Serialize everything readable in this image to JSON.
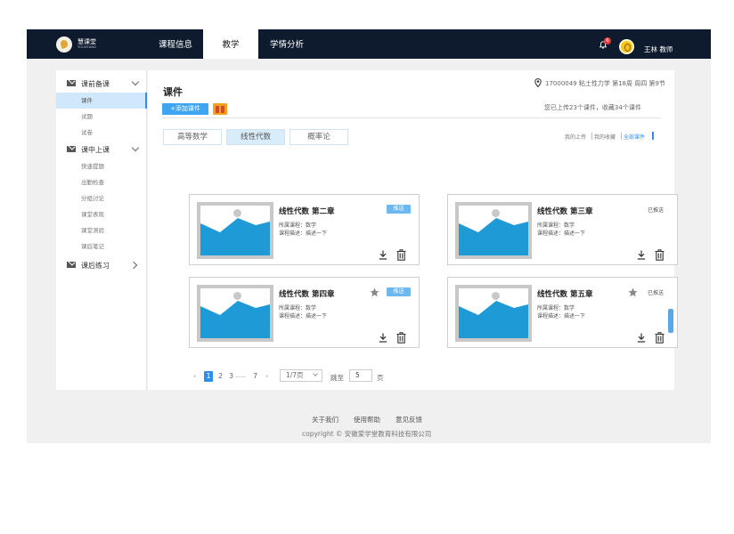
{
  "brand": {
    "name": "慧课堂",
    "name_en": "YOUKTANG"
  },
  "nav": {
    "tabs": [
      {
        "label": "课程信息"
      },
      {
        "label": "教学"
      },
      {
        "label": "学情分析"
      }
    ],
    "notification_count": "6",
    "user": "王林  教师"
  },
  "sidebar": {
    "groups": [
      {
        "label": "课前备课",
        "items": [
          "课件",
          "试题",
          "试卷"
        ]
      },
      {
        "label": "课中上课",
        "items": [
          "快速提题",
          "出勤检查",
          "分组讨论",
          "课堂表现",
          "课堂测验",
          "课后笔记"
        ]
      },
      {
        "label": "课后练习",
        "items": []
      }
    ]
  },
  "main": {
    "title": "课件",
    "add_button": "+添加课件",
    "location": "17000049 粘土性力学 第18周 周四 第9节",
    "stats": "您已上传23个课件，收藏34个课件",
    "course_tabs": [
      "高等数学",
      "线性代数",
      "概率论"
    ],
    "active_course_tab": 1,
    "filters": [
      "我的上传",
      "我的收藏",
      "全部课件"
    ],
    "active_filter": 2
  },
  "cards": [
    {
      "title": "线性代数 第二章",
      "course": "所属课程：数学",
      "desc": "课程描述：描述一下",
      "badge": "推送",
      "status": "",
      "starred": false
    },
    {
      "title": "线性代数 第三章",
      "course": "所属课程：数学",
      "desc": "课程描述：描述一下",
      "badge": "",
      "status": "已推送",
      "starred": false
    },
    {
      "title": "线性代数 第四章",
      "course": "所属课程：数学",
      "desc": "课程描述：描述一下",
      "badge": "推送",
      "status": "",
      "starred": true
    },
    {
      "title": "线性代数 第五章",
      "course": "所属课程：数学",
      "desc": "课程描述：描述一下",
      "badge": "",
      "status": "已推送",
      "starred": true
    }
  ],
  "pagination": {
    "prev": "‹",
    "pages": [
      "1",
      "2",
      "3",
      "……",
      "7"
    ],
    "current": "1",
    "next": "›",
    "page_select": "1/7页",
    "jump_label": "跳至",
    "jump_value": "5",
    "page_unit": "页"
  },
  "footer": {
    "links": [
      "关于我们",
      "使用帮助",
      "意见反馈"
    ],
    "copyright": "copyright © 安徽爱学堂教育科技有限公司"
  },
  "colors": {
    "nav_bg": "#0e1b2e",
    "accent": "#2d8ff0",
    "badge": "#6cb8f0",
    "thumb_blue": "#1e9ad6"
  }
}
